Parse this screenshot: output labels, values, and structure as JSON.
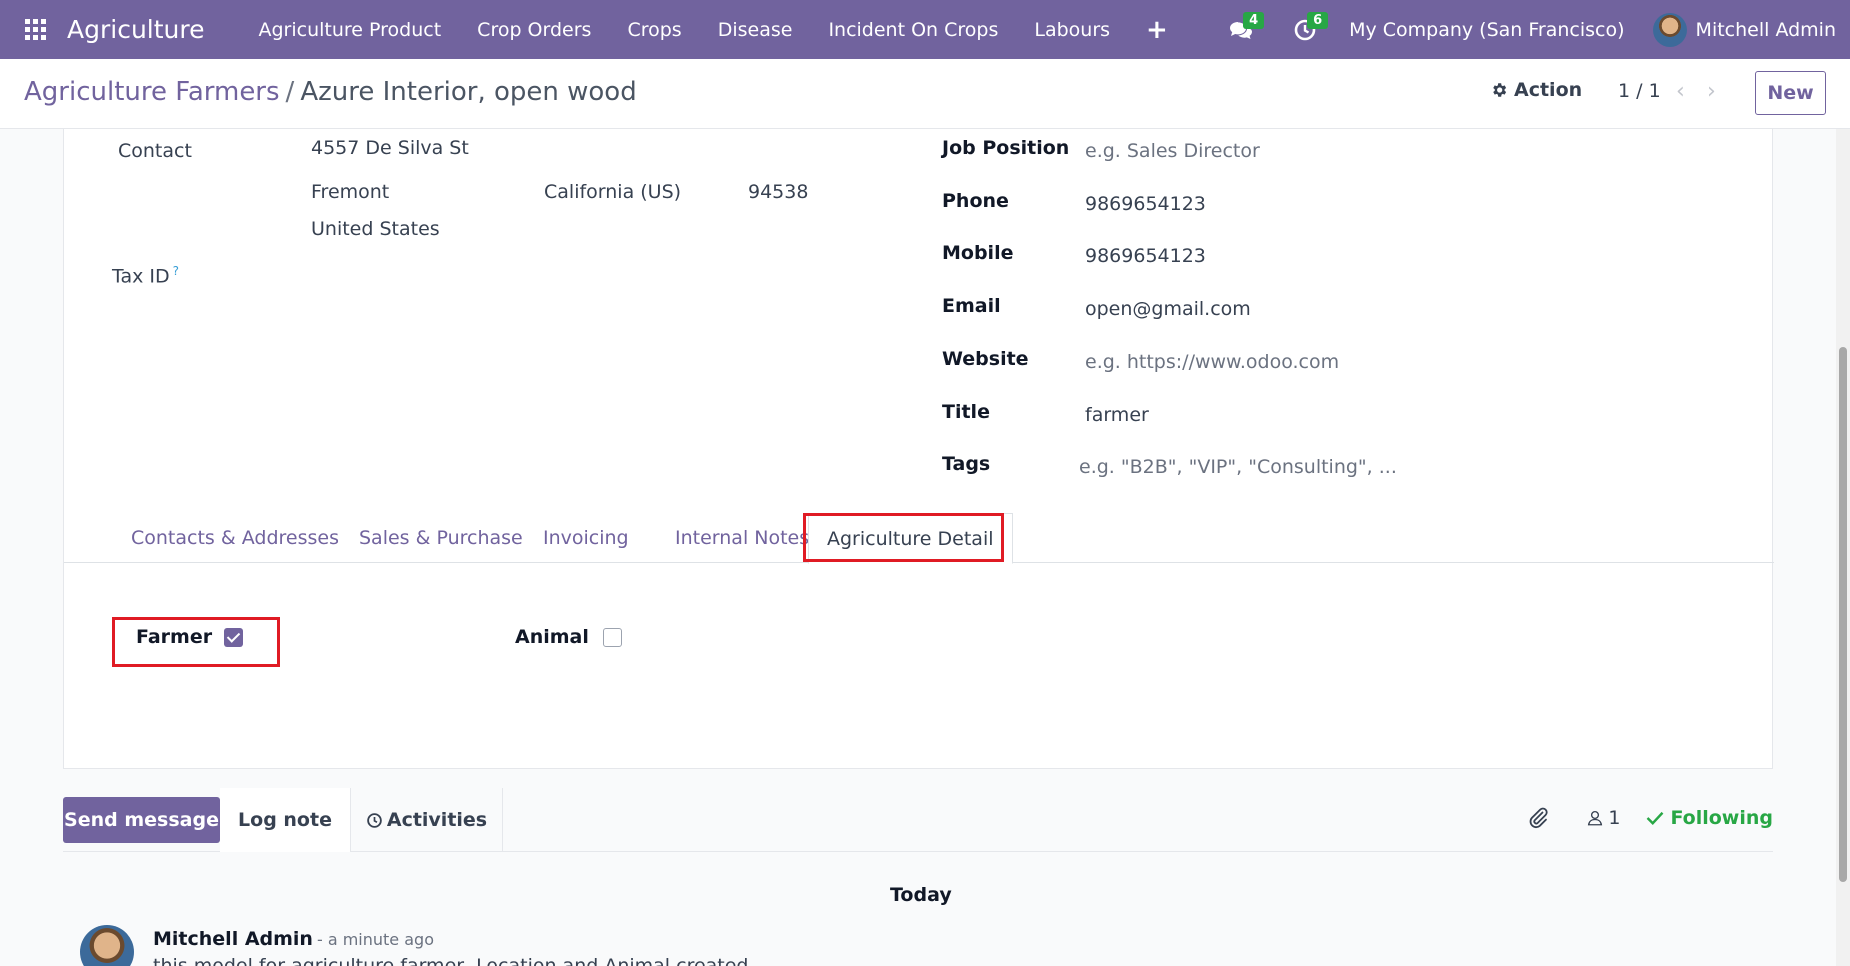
{
  "navbar": {
    "brand": "Agriculture",
    "menu": [
      "Agriculture Product",
      "Crop Orders",
      "Crops",
      "Disease",
      "Incident On Crops",
      "Labours"
    ],
    "plus": "+",
    "messages_count": "4",
    "activities_count": "6",
    "company": "My Company (San Francisco)",
    "user": "Mitchell Admin"
  },
  "control": {
    "breadcrumb_parent": "Agriculture Farmers",
    "breadcrumb_sep": "/",
    "breadcrumb_current": "Azure Interior, open wood",
    "action_label": "Action",
    "pager": "1 / 1",
    "new_label": "New"
  },
  "form": {
    "contact_label": "Contact",
    "street": "4557 De Silva St",
    "city": "Fremont",
    "state": "California (US)",
    "zip": "94538",
    "country": "United States",
    "tax_label": "Tax ID",
    "tax_help": "?",
    "job_label": "Job Position",
    "job_placeholder": "e.g. Sales Director",
    "phone_label": "Phone",
    "phone": "9869654123",
    "mobile_label": "Mobile",
    "mobile": "9869654123",
    "email_label": "Email",
    "email": "open@gmail.com",
    "website_label": "Website",
    "website_placeholder": "e.g. https://www.odoo.com",
    "title_label": "Title",
    "title": "farmer",
    "tags_label": "Tags",
    "tags_placeholder": "e.g. \"B2B\", \"VIP\", \"Consulting\", ..."
  },
  "tabs": [
    "Contacts & Addresses",
    "Sales & Purchase",
    "Invoicing",
    "Internal Notes",
    "Agriculture Detail"
  ],
  "active_tab": "Agriculture Detail",
  "agri": {
    "farmer_label": "Farmer",
    "farmer_checked": true,
    "animal_label": "Animal",
    "animal_checked": false
  },
  "chatter": {
    "send_label": "Send message",
    "log_label": "Log note",
    "activities_label": "Activities",
    "followers_count": "1",
    "following_label": "Following",
    "date_separator": "Today",
    "message_author": "Mitchell Admin",
    "message_date": "- a minute ago",
    "message_body": "this model for agriculture farmer, Location and Animal created"
  },
  "colors": {
    "brand": "#71639e",
    "highlight": "#e01b24",
    "success": "#28a745"
  }
}
